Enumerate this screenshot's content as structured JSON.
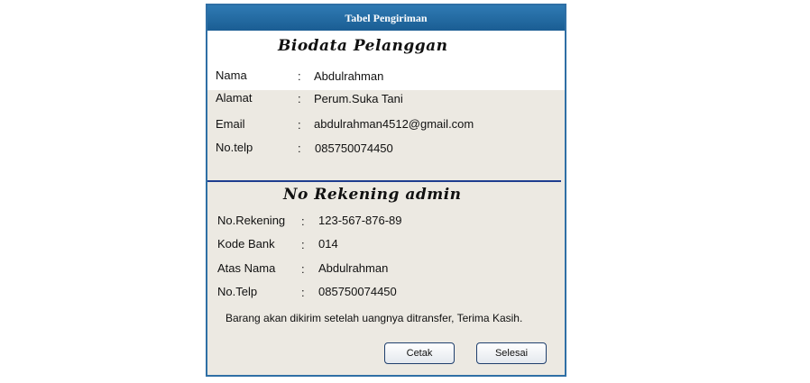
{
  "window": {
    "title": "Tabel Pengiriman"
  },
  "customer": {
    "heading": "Biodata Pelanggan",
    "rows": [
      {
        "label": "Nama",
        "sep": ":",
        "value": "Abdulrahman"
      },
      {
        "label": "Alamat",
        "sep": ":",
        "value": "Perum.Suka Tani"
      },
      {
        "label": "Email",
        "sep": ":",
        "value": "abdulrahman4512@gmail.com"
      },
      {
        "label": "No.telp",
        "sep": ":",
        "value": "085750074450"
      }
    ]
  },
  "account": {
    "heading": "No Rekening admin",
    "rows": [
      {
        "label": "No.Rekening",
        "sep": ":",
        "value": "123-567-876-89"
      },
      {
        "label": "Kode Bank",
        "sep": ":",
        "value": "014"
      },
      {
        "label": "Atas Nama",
        "sep": ":",
        "value": "Abdulrahman"
      },
      {
        "label": "No.Telp",
        "sep": ":",
        "value": "085750074450"
      }
    ]
  },
  "note": "Barang akan dikirim setelah uangnya ditransfer, Terima Kasih.",
  "buttons": {
    "print": "Cetak",
    "finish": "Selesai"
  }
}
